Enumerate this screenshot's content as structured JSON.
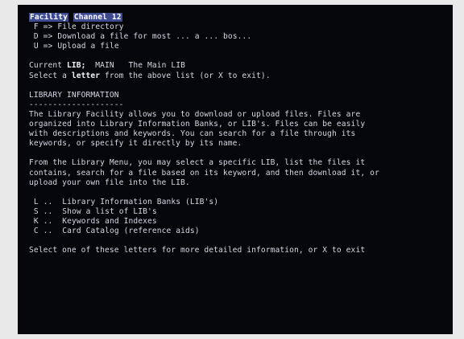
{
  "header": {
    "tag1": "Facility",
    "tag2": "Channel 12"
  },
  "menu": [
    {
      "key": "F",
      "arrow": "=>",
      "label": "File directory"
    },
    {
      "key": "D",
      "arrow": "=>",
      "label": "Download a file for most ... a ... bos..."
    },
    {
      "key": "U",
      "arrow": "=>",
      "label": "Upload a file"
    }
  ],
  "status": {
    "current_lib_prefix": "Current ",
    "current_lib_label": "LIB;",
    "current_lib_value": "MAIN",
    "current_lib_name": "The Main LIB",
    "prompt_prefix": "Select a ",
    "prompt_bold": "letter",
    "prompt_suffix": " from the above list (or X to exit)."
  },
  "info": {
    "heading": "LIBRARY INFORMATION",
    "underline": "--------------------",
    "paragraph1": [
      "The Library Facility allows you to download or upload files. Files are",
      "organized into Library Information Banks, or LIB's. Files can be easily",
      "with descriptions and keywords. You can search for a file through its",
      "keywords, or specify it directly by its name."
    ],
    "paragraph2": [
      "From the Library Menu, you may select a specific LIB, list the files it",
      "contains, search for a file based on its keyword, and then download it, or",
      "upload your own file into the LIB."
    ]
  },
  "options": [
    {
      "key": "L",
      "sep": "..",
      "label": "Library Information Banks (LIB's)"
    },
    {
      "key": "S",
      "sep": "..",
      "label": "Show a list of LIB's"
    },
    {
      "key": "K",
      "sep": "..",
      "label": "Keywords and Indexes"
    },
    {
      "key": "C",
      "sep": "..",
      "label": "Card Catalog (reference aids)"
    }
  ],
  "footer": {
    "prompt": "Select one of these letters for more detailed information, or X to exit"
  }
}
